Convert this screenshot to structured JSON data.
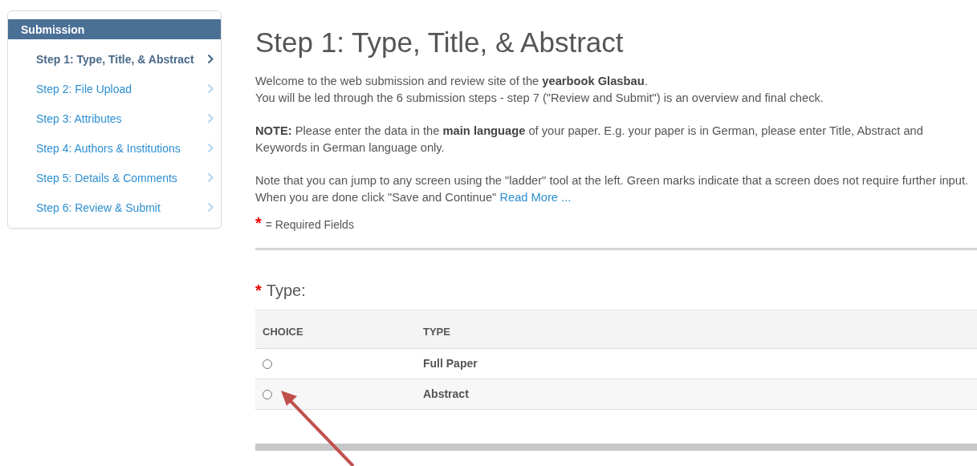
{
  "sidebar": {
    "title": "Submission",
    "items": [
      {
        "label": "Step 1: Type, Title, & Abstract",
        "selected": true
      },
      {
        "label": "Step 2: File Upload",
        "selected": false
      },
      {
        "label": "Step 3: Attributes",
        "selected": false
      },
      {
        "label": "Step 4: Authors & Institutions",
        "selected": false
      },
      {
        "label": "Step 5: Details & Comments",
        "selected": false
      },
      {
        "label": "Step 6: Review & Submit",
        "selected": false
      }
    ]
  },
  "main": {
    "title": "Step 1: Type, Title, & Abstract",
    "intro": [
      "Welcome to the web submission and review site of the **yearbook Glasbau**.",
      "You will be led through the 6 submission steps - step 7 (\"Review and Submit\") is an overview and final check."
    ],
    "note": "**NOTE:** Please enter the data in the **main language** of your paper. E.g. your paper is in German, please enter Title, Abstract and Keywords in German language only.",
    "ladder": [
      "Note that you can jump to any screen using the \"ladder\" tool at the left. Green marks indicate that a screen does not require further input.",
      "When you are done click \"Save and Continue\""
    ],
    "read_more_link": "Read More ...",
    "required_legend": {
      "mark": "*",
      "text": "= Required Fields"
    },
    "type_section": {
      "mark": "*",
      "label": "Type:",
      "columns": [
        "CHOICE",
        "TYPE"
      ],
      "rows": [
        {
          "label": "Full Paper",
          "selected": false
        },
        {
          "label": "Abstract",
          "selected": false
        }
      ]
    }
  }
}
